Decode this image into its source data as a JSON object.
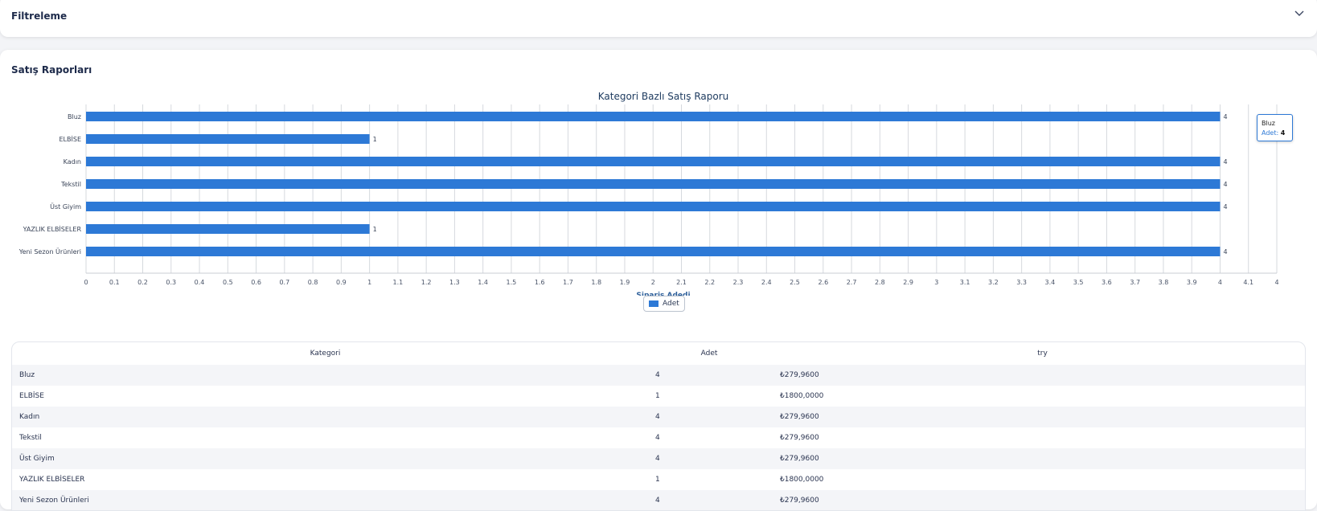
{
  "filter": {
    "title": "Filtreleme",
    "toggle_icon": "chevron-down-icon"
  },
  "report": {
    "title": "Satış Raporları"
  },
  "chart_data": {
    "type": "bar",
    "orientation": "horizontal",
    "title": "Kategori Bazlı Satış Raporu",
    "xlabel": "Sipariş Adedi",
    "ylabel": "",
    "categories": [
      "Bluz",
      "ELBİSE",
      "Kadın",
      "Tekstil",
      "Üst Giyim",
      "YAZLIK ELBİSELER",
      "Yeni Sezon Ürünleri"
    ],
    "series": [
      {
        "name": "Adet",
        "values": [
          4,
          1,
          4,
          4,
          4,
          1,
          4
        ]
      }
    ],
    "xlim": [
      0,
      4.2
    ],
    "x_ticks": [
      "0",
      "0.1",
      "0.2",
      "0.3",
      "0.4",
      "0.5",
      "0.6",
      "0.7",
      "0.8",
      "0.9",
      "1",
      "1.1",
      "1.2",
      "1.3",
      "1.4",
      "1.5",
      "1.6",
      "1.7",
      "1.8",
      "1.9",
      "2",
      "2.1",
      "2.2",
      "2.3",
      "2.4",
      "2.5",
      "2.6",
      "2.7",
      "2.8",
      "2.9",
      "3",
      "3.1",
      "3.2",
      "3.3",
      "3.4",
      "3.5",
      "3.6",
      "3.7",
      "3.8",
      "3.9",
      "4",
      "4.1",
      "4"
    ],
    "grid": true,
    "legend": "bottom-center",
    "data_labels": true,
    "color": "#2d79d6"
  },
  "tooltip": {
    "title": "Bluz",
    "key": "Adet:",
    "value": "4"
  },
  "legend": {
    "label": "Adet"
  },
  "table": {
    "headers": [
      "Kategori",
      "Adet",
      "try"
    ],
    "rows": [
      [
        "Bluz",
        "4",
        "₺279,9600"
      ],
      [
        "ELBİSE",
        "1",
        "₺1800,0000"
      ],
      [
        "Kadın",
        "4",
        "₺279,9600"
      ],
      [
        "Tekstil",
        "4",
        "₺279,9600"
      ],
      [
        "Üst Giyim",
        "4",
        "₺279,9600"
      ],
      [
        "YAZLIK ELBİSELER",
        "1",
        "₺1800,0000"
      ],
      [
        "Yeni Sezon Ürünleri",
        "4",
        "₺279,9600"
      ]
    ]
  }
}
